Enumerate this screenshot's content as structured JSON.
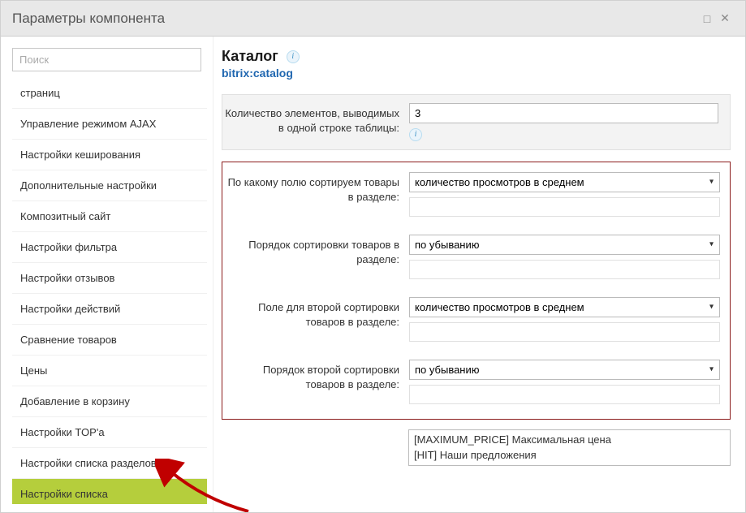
{
  "titlebar": {
    "title": "Параметры компонента"
  },
  "search": {
    "placeholder": "Поиск"
  },
  "sidebar": {
    "items": [
      {
        "label": "страниц"
      },
      {
        "label": "Управление режимом AJAX"
      },
      {
        "label": "Настройки кеширования"
      },
      {
        "label": "Дополнительные настройки"
      },
      {
        "label": "Композитный сайт"
      },
      {
        "label": "Настройки фильтра"
      },
      {
        "label": "Настройки отзывов"
      },
      {
        "label": "Настройки действий"
      },
      {
        "label": "Сравнение товаров"
      },
      {
        "label": "Цены"
      },
      {
        "label": "Добавление в корзину"
      },
      {
        "label": "Настройки TOP'а"
      },
      {
        "label": "Настройки списка разделов"
      },
      {
        "label": "Настройки списка",
        "active": true
      }
    ]
  },
  "header": {
    "title": "Каталог",
    "component": "bitrix:catalog"
  },
  "fields": {
    "elements_per_row": {
      "label": "Количество элементов, выводимых в одной строке таблицы:",
      "value": "3"
    },
    "sort1_field": {
      "label": "По какому полю сортируем товары в разделе:",
      "value": "количество просмотров в среднем"
    },
    "sort1_order": {
      "label": "Порядок сортировки товаров в разделе:",
      "value": "по убыванию"
    },
    "sort2_field": {
      "label": "Поле для второй сортировки товаров в разделе:",
      "value": "количество просмотров в среднем"
    },
    "sort2_order": {
      "label": "Порядок второй сортировки товаров в разделе:",
      "value": "по убыванию"
    },
    "listbox": {
      "options": [
        "[MAXIMUM_PRICE] Максимальная цена",
        "[HIT] Наши предложения"
      ]
    }
  }
}
